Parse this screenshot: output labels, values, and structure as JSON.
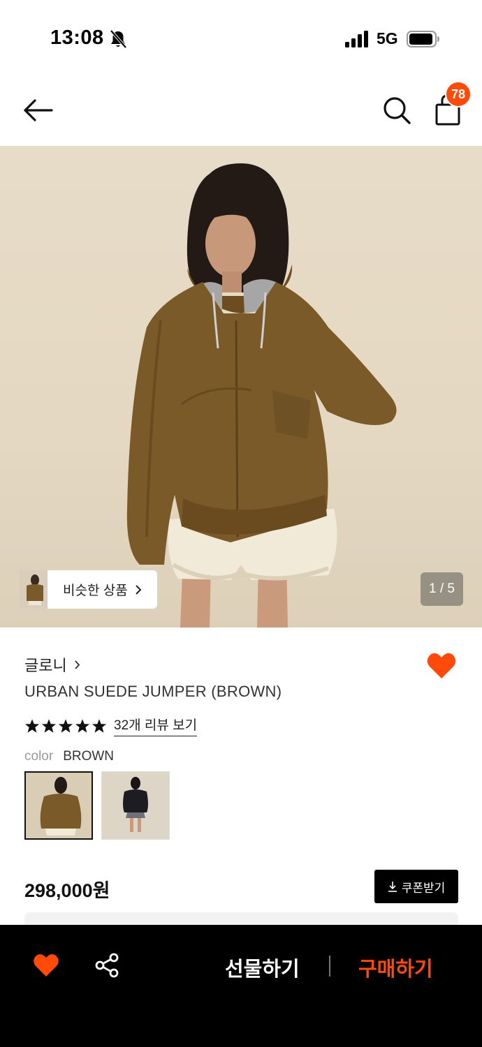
{
  "status_bar": {
    "time": "13:08",
    "network": "5G",
    "icons": [
      "bell-slash-icon",
      "signal-icon",
      "battery-icon"
    ]
  },
  "header": {
    "icons": [
      "back-arrow-icon",
      "search-icon",
      "shopping-bag-icon"
    ],
    "cart_count": "78"
  },
  "gallery": {
    "similar_label": "비슷한 상품",
    "counter": "1 / 5"
  },
  "product": {
    "brand": "글로니",
    "name": "URBAN SUEDE JUMPER (BROWN)",
    "rating_stars": 5,
    "reviews_link": "32개 리뷰 보기",
    "color_label": "color",
    "color_value": "BROWN",
    "price": "298,000원",
    "coupon_label": "쿠폰받기"
  },
  "bottom_bar": {
    "gift_label": "선물하기",
    "buy_label": "구매하기"
  },
  "colors": {
    "accent": "#ff4a0a",
    "black": "#000000",
    "jacket": "#7b5a2a"
  }
}
